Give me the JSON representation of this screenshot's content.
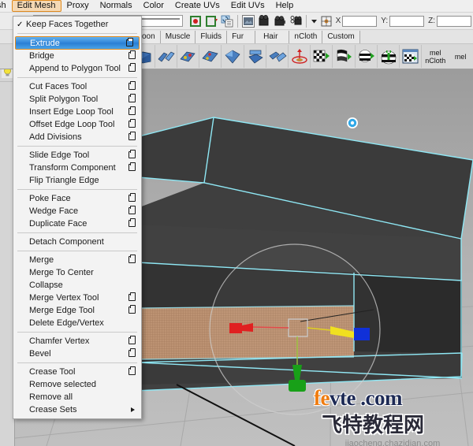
{
  "menubar": {
    "items": [
      {
        "label": "sh",
        "active": false,
        "clipped": true
      },
      {
        "label": "Edit Mesh",
        "active": true
      },
      {
        "label": "Proxy",
        "active": false
      },
      {
        "label": "Normals",
        "active": false
      },
      {
        "label": "Color",
        "active": false
      },
      {
        "label": "Create UVs",
        "active": false
      },
      {
        "label": "Edit UVs",
        "active": false
      },
      {
        "label": "Help",
        "active": false
      }
    ]
  },
  "statusline": {
    "x_label": "X",
    "y_label": "Y:",
    "z_label": "Z:",
    "x_value": "",
    "y_value": "",
    "z_value": "",
    "icons": [
      "snap-to-grid-icon",
      "snap-to-curve-icon",
      "snap-to-point-icon",
      "history-icon",
      "render-view-icon",
      "render-current-frame-icon",
      "ipr-render-icon",
      "render-settings-icon"
    ]
  },
  "shelf_tabs": {
    "tabs": [
      {
        "label": "oon",
        "clipped": true
      },
      {
        "label": "Muscle"
      },
      {
        "label": "Fluids"
      },
      {
        "label": "Fur"
      },
      {
        "label": "Hair"
      },
      {
        "label": "nCloth"
      },
      {
        "label": "Custom"
      }
    ]
  },
  "shelf_icons": {
    "items": [
      {
        "name": "ncloth-create-icon"
      },
      {
        "name": "ncloth-passive-collider-icon"
      },
      {
        "name": "ncloth-create-constraint-icon"
      },
      {
        "name": "ncloth-component-constraint-icon"
      },
      {
        "name": "ncloth-transform-constraint-icon"
      },
      {
        "name": "ncloth-point-to-surface-icon"
      },
      {
        "name": "ncloth-tearable-surface-icon"
      },
      {
        "name": "nparticle-emitter-icon"
      },
      {
        "name": "ncloth-display-current-icon"
      },
      {
        "name": "ncloth-display-input-icon"
      },
      {
        "name": "ncloth-display-start-icon"
      },
      {
        "name": "ncloth-set-initial-state-icon"
      },
      {
        "name": "ncloth-cache-icon"
      }
    ],
    "mel_buttons": [
      {
        "label": "mel",
        "sublabel": "nCloth"
      },
      {
        "label": "mel",
        "sublabel": ""
      }
    ]
  },
  "left_toolbar": {
    "items": [
      {
        "name": "sphere-primitive-icon"
      },
      {
        "name": "light-bulb-icon"
      }
    ]
  },
  "dropdown": {
    "title": "Edit Mesh",
    "groups": [
      {
        "items": [
          {
            "label": "Keep Faces Together",
            "checked": true,
            "option_box": false,
            "selected": false
          }
        ]
      },
      {
        "items": [
          {
            "label": "Extrude",
            "option_box": true,
            "selected": true
          },
          {
            "label": "Bridge",
            "option_box": true,
            "selected": false
          },
          {
            "label": "Append to Polygon Tool",
            "option_box": true,
            "selected": false
          }
        ]
      },
      {
        "items": [
          {
            "label": "Cut Faces Tool",
            "option_box": true,
            "selected": false
          },
          {
            "label": "Split Polygon Tool",
            "option_box": true,
            "selected": false
          },
          {
            "label": "Insert Edge Loop Tool",
            "option_box": true,
            "selected": false
          },
          {
            "label": "Offset Edge Loop Tool",
            "option_box": true,
            "selected": false
          },
          {
            "label": "Add Divisions",
            "option_box": true,
            "selected": false
          }
        ]
      },
      {
        "items": [
          {
            "label": "Slide Edge Tool",
            "option_box": true,
            "selected": false
          },
          {
            "label": "Transform Component",
            "option_box": true,
            "selected": false
          },
          {
            "label": "Flip Triangle Edge",
            "option_box": false,
            "selected": false
          }
        ]
      },
      {
        "items": [
          {
            "label": "Poke Face",
            "option_box": true,
            "selected": false
          },
          {
            "label": "Wedge Face",
            "option_box": true,
            "selected": false
          },
          {
            "label": "Duplicate Face",
            "option_box": true,
            "selected": false
          }
        ]
      },
      {
        "items": [
          {
            "label": "Detach Component",
            "option_box": false,
            "selected": false
          }
        ]
      },
      {
        "items": [
          {
            "label": "Merge",
            "option_box": true,
            "selected": false
          },
          {
            "label": "Merge To Center",
            "option_box": false,
            "selected": false
          },
          {
            "label": "Collapse",
            "option_box": false,
            "selected": false
          },
          {
            "label": "Merge Vertex Tool",
            "option_box": true,
            "selected": false
          },
          {
            "label": "Merge Edge Tool",
            "option_box": true,
            "selected": false
          },
          {
            "label": "Delete Edge/Vertex",
            "option_box": false,
            "selected": false
          }
        ]
      },
      {
        "items": [
          {
            "label": "Chamfer Vertex",
            "option_box": true,
            "selected": false
          },
          {
            "label": "Bevel",
            "option_box": true,
            "selected": false
          }
        ]
      },
      {
        "items": [
          {
            "label": "Crease Tool",
            "option_box": true,
            "selected": false
          },
          {
            "label": "Remove selected",
            "option_box": false,
            "selected": false
          },
          {
            "label": "Remove all",
            "option_box": false,
            "selected": false
          },
          {
            "label": "Crease Sets",
            "option_box": false,
            "submenu": true,
            "selected": false
          }
        ]
      }
    ]
  },
  "viewport": {
    "name": "perspective-viewport",
    "description": "3D perspective view showing an extruded box mesh with cyan selected edges, a selected face highlighted in orange, and a move manipulator",
    "manipulator": {
      "x_axis_color": "#e02020",
      "y_axis_color": "#18a018",
      "z_axis_color": "#1030d8",
      "center_color": "#f0e020"
    },
    "selection_color": "#8fe8f5",
    "face_highlight_color": "#d8a070"
  },
  "watermark": {
    "site_part1": "fe",
    "site_part2": "vte",
    "site_part3": " .com",
    "chinese": "飞特教程网",
    "sub": "jiaocheng.chazidian.com",
    "orange": "#ef7c10",
    "navy": "#1d2a55"
  }
}
